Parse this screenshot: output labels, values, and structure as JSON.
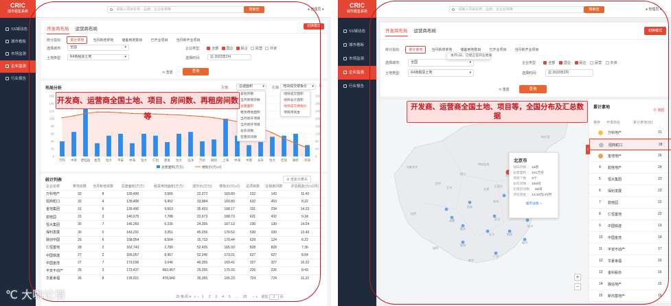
{
  "logo": {
    "title": "CRIC",
    "subtitle": "城市租售系统"
  },
  "sidebar": [
    {
      "label": "SS城动态",
      "icon": "news-icon"
    },
    {
      "label": "城市看板",
      "icon": "dashboard-icon"
    },
    {
      "label": "市场监测",
      "icon": "monitor-icon"
    },
    {
      "label": "企业监测",
      "icon": "enterprise-icon",
      "active": true
    },
    {
      "label": "行业报告",
      "icon": "report-icon"
    }
  ],
  "topbar": {
    "search_placeholder": "请输入项目名称、品牌、企业名称等",
    "search_btn": "搜索查",
    "user": "管理员"
  },
  "tabs": [
    "开发商布局",
    "运营商布局"
  ],
  "map_mode_btn": "切换模式",
  "filters": {
    "metric_label": "统计指标:",
    "metrics": [
      "累计拿地",
      "当月新增拿地",
      "储备用地数目",
      "已开业项目",
      "当月新开业项目"
    ],
    "city_label": "选择城市:",
    "city_value": "全国",
    "land_label": "土地类型:",
    "land_value": "R4商租赁土地",
    "type_label": "企业类型:",
    "types": [
      "全部",
      "国企",
      "民企",
      "民营",
      "外资"
    ],
    "time_label": "选择时间:",
    "time_value": "2022年2月",
    "reset": "重置",
    "query": "查询"
  },
  "annotations": {
    "left": "开发商、运营商全国土地、项目、房间数、再租房间数等",
    "right": "开发商、运营商全国土地、项目等，全国分布及汇总数据"
  },
  "left": {
    "chart_title": "布局分析",
    "ctrl_left_label": "左轴",
    "ctrl_left_value": "总建面积",
    "ctrl_right_label": "右轴",
    "ctrl_right_value": "地块成交楼板价",
    "dropdown_left": [
      "拿地宗数",
      "当月新增宗数",
      "总建面积",
      "租赁用地面积",
      "当月新开项目",
      "当月新开项目",
      "总房间数",
      "在租房间数"
    ],
    "dropdown_right": [
      "地块成交面积",
      "地块总计面积",
      "地块成交楼板价",
      "项目待资金"
    ],
    "list_title": "统计列表",
    "export": "自定义表头",
    "columns": [
      "企业名称",
      "拿地宗数",
      "当月新增宗数",
      "总建面积(万方)",
      "租赁用地面积(万方)",
      "成交价(万元)",
      "楼板价(元/㎡)",
      "总项目数",
      "在租房间数",
      "评估租金(元/㎡/月)"
    ],
    "rows": [
      [
        "万科地产",
        "32",
        "8",
        "139,490",
        "3,566",
        "22,372",
        "169.80",
        "232",
        "143",
        "11.43"
      ],
      [
        "招商蛇口",
        "32",
        "4",
        "139,490",
        "9,452",
        "33,984",
        "169.80",
        "632",
        "453",
        "8.22"
      ],
      [
        "金地集团",
        "31",
        "6",
        "139,490",
        "9,663",
        "35,433",
        "168.17",
        "331",
        "234",
        "14.23"
      ],
      [
        "碧桂园",
        "31",
        "3",
        "140,975",
        "7,788",
        "22,673",
        "168.73",
        "631",
        "432",
        "9.24"
      ],
      [
        "恒大集团",
        "30",
        "7",
        "146,260",
        "6,235",
        "24,355",
        "167.13",
        "230",
        "130",
        "14.24"
      ],
      [
        "保利发展",
        "30",
        "0",
        "143,291",
        "3,251",
        "45,256",
        "170.52",
        "530",
        "330",
        "13.43"
      ],
      [
        "融创中国",
        "29",
        "6",
        "158,954",
        "8,564",
        "15,733",
        "170.44",
        "629",
        "124",
        "6.22"
      ],
      [
        "仁恒置地",
        "28",
        "2",
        "162,743",
        "2,789",
        "52,435",
        "165.93",
        "828",
        "828",
        "7.36"
      ],
      [
        "中国铁建",
        "27",
        "2",
        "165,957",
        "8,957",
        "52,245",
        "173.01",
        "627",
        "627",
        "8.64"
      ],
      [
        "中国金茂",
        "27",
        "7",
        "173,036",
        "3,046",
        "46,355",
        "169.41",
        "327",
        "327",
        "16.22"
      ],
      [
        "平安不动产",
        "26",
        "3",
        "173,437",
        "683,457",
        "25,255",
        "170.33",
        "226",
        "226",
        "8.43"
      ],
      [
        "华夏幸福",
        "26",
        "8",
        "178,921",
        "478,940",
        "35,355",
        "165.23",
        "724",
        "724",
        "11.22"
      ]
    ],
    "pager": {
      "per_page": "20 条/页",
      "pages": [
        "1",
        "2",
        "3",
        "4",
        "5",
        "...",
        "25"
      ],
      "goto": "前往",
      "page": "1",
      "suffix": "页"
    }
  },
  "chart_data": {
    "type": "bar",
    "categories": [
      "万科",
      "中梁",
      "碧桂园",
      "金茂",
      "恒大",
      "平安",
      "中海",
      "恒大",
      "仁恒",
      "建发",
      "恒大",
      "远洋",
      "万达",
      "融创",
      "上海",
      "中海",
      "中南",
      "长升",
      "恒大",
      "佳兆",
      "融侨",
      "华润"
    ],
    "series": [
      {
        "name": "总建面积(万方)",
        "type": "bar",
        "values": [
          40,
          65,
          150,
          35,
          55,
          60,
          35,
          60,
          55,
          38,
          60,
          65,
          40,
          45,
          100,
          55,
          30,
          38,
          52,
          55,
          60,
          30
        ]
      },
      {
        "name": "楼板价(元/㎡)",
        "type": "line",
        "values": [
          205,
          215,
          228,
          235,
          235,
          232,
          228,
          226,
          225,
          222,
          220,
          216,
          212,
          205,
          196,
          185,
          170,
          150,
          125,
          95,
          70,
          45
        ]
      }
    ],
    "y_left_ticks": [
      "0",
      "20",
      "40",
      "60",
      "80",
      "100",
      "120",
      "140",
      "160"
    ],
    "y_right_ticks": [
      "0",
      "40",
      "80",
      "120",
      "160",
      "200",
      "240",
      "280",
      "320"
    ],
    "ylim_left": [
      0,
      160
    ],
    "ylim_right": [
      0,
      320
    ],
    "legend_position": "bottom-center"
  },
  "right": {
    "tooltip_lines": [
      "本月1日，已经正常开业地块"
    ],
    "city_popup": {
      "title": "北京市",
      "rows": [
        [
          "地块宗数",
          "18宗"
        ],
        [
          "总建面积",
          "101万方"
        ],
        [
          "项目个数",
          "8个"
        ],
        [
          "总房间数",
          "160间"
        ],
        [
          "在租房间数",
          "60间"
        ],
        [
          "评估租金",
          "13.33元/㎡/月"
        ]
      ],
      "link": "城市详情 >"
    },
    "map_labels": [
      "北京",
      "天津",
      "石家庄",
      "太原",
      "西安",
      "郑州",
      "济南",
      "武汉",
      "南京",
      "上海",
      "杭州",
      "长沙",
      "南昌",
      "福州",
      "重庆",
      "成都",
      "昆明",
      "贵阳",
      "南宁",
      "广州",
      "兰州",
      "西宁",
      "银川",
      "呼和浩特",
      "沈阳",
      "哈尔滨",
      "乌鲁木齐",
      "拉萨"
    ],
    "rank_title": "累计拿地",
    "rank_toggle": "收起",
    "rank_cols": [
      "排序",
      "开发商名",
      "累计拿地(宗)"
    ],
    "ranks": [
      [
        "1",
        "万科地产",
        "31"
      ],
      [
        "2",
        "招商蛇口",
        "28"
      ],
      [
        "3",
        "金地地产",
        "26"
      ],
      [
        "4",
        "碧桂地产",
        "24"
      ],
      [
        "5",
        "恒大集团",
        "23"
      ],
      [
        "6",
        "保利发展",
        "23"
      ],
      [
        "7",
        "碧桂园",
        "22"
      ],
      [
        "8",
        "仁恒置地",
        "22"
      ],
      [
        "9",
        "中国铁建",
        "19"
      ],
      [
        "10",
        "中国金茂",
        "18"
      ],
      [
        "11",
        "平安不动产",
        "17"
      ],
      [
        "12",
        "华夏幸福",
        "16"
      ],
      [
        "13",
        "金科股份",
        "16"
      ],
      [
        "14",
        "融信地产",
        "15"
      ],
      [
        "15",
        "新鸿基地产",
        "15"
      ]
    ]
  },
  "watermark": "大咖论谱"
}
